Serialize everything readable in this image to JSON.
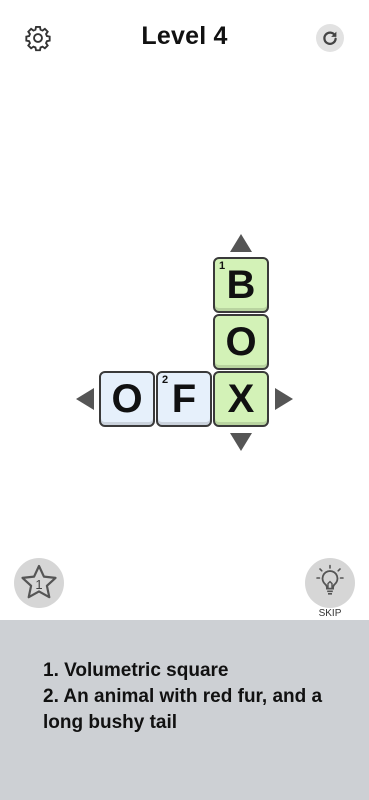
{
  "header": {
    "title": "Level 4",
    "left_icon": "gear-icon",
    "right_icon": "reset-icon"
  },
  "board": {
    "tiles": [
      {
        "letter": "B",
        "number": "1",
        "color": "green"
      },
      {
        "letter": "O",
        "number": "",
        "color": "green"
      },
      {
        "letter": "O",
        "number": "",
        "color": "blue"
      },
      {
        "letter": "F",
        "number": "2",
        "color": "blue"
      },
      {
        "letter": "X",
        "number": "",
        "color": "green"
      }
    ],
    "colors": {
      "blue_tile": "#e6f0fb",
      "green_tile": "#d3f2b7",
      "arrow": "#555555"
    }
  },
  "bottom": {
    "star_count": "1",
    "skip_label": "SKIP"
  },
  "clues": [
    "1. Volumetric square",
    "2. An animal with red fur, and a long bushy tail"
  ],
  "colors": {
    "clue_panel": "#cdd0d4",
    "background": "#ffffff"
  }
}
